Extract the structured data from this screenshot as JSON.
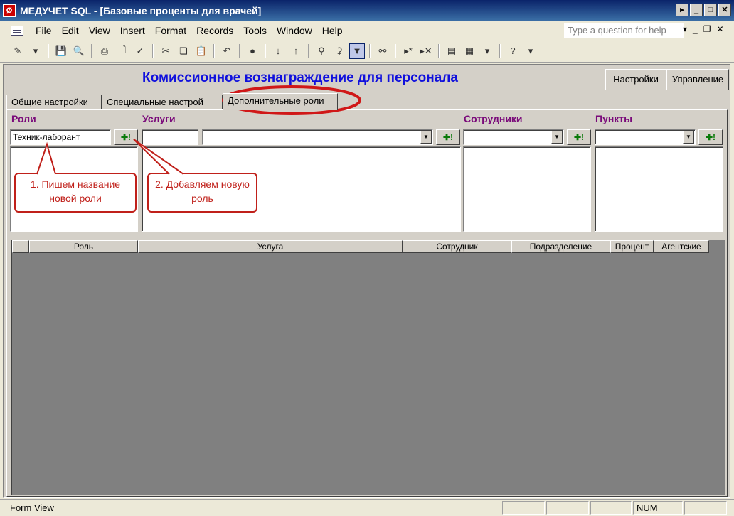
{
  "window": {
    "title": "МЕДУЧЕТ SQL - [Базовые проценты для врачей]",
    "app_icon": "access-icon"
  },
  "menu": {
    "items": [
      "File",
      "Edit",
      "View",
      "Insert",
      "Format",
      "Records",
      "Tools",
      "Window",
      "Help"
    ],
    "ask_placeholder": "Type a question for help"
  },
  "form": {
    "title": "Комиссионное вознаграждение для персонала",
    "settings_button": "Настройки",
    "manage_button": "Управление",
    "tabs": [
      "Общие настройки",
      "Специальные настрой",
      "Дополнительные роли"
    ],
    "active_tab": 2
  },
  "sections": {
    "roles": {
      "label": "Роли",
      "input_value": "Техник-лаборант",
      "add_label": "✚!"
    },
    "services": {
      "label": "Услуги",
      "code_value": "",
      "select_value": "",
      "add_label": "✚!"
    },
    "employees": {
      "label": "Сотрудники",
      "select_value": "",
      "add_label": "✚!"
    },
    "points": {
      "label": "Пункты",
      "select_value": "",
      "add_label": "✚!"
    }
  },
  "grid": {
    "columns": [
      "",
      "Роль",
      "Услуга",
      "Сотрудник",
      "Подразделение",
      "Процент",
      "Агентские"
    ],
    "rows": []
  },
  "annotations": {
    "step1": "1. Пишем название новой роли",
    "step2": "2. Добавляем новую роль",
    "color": "#c0201a"
  },
  "status": {
    "left": "Form View",
    "num": "NUM"
  }
}
